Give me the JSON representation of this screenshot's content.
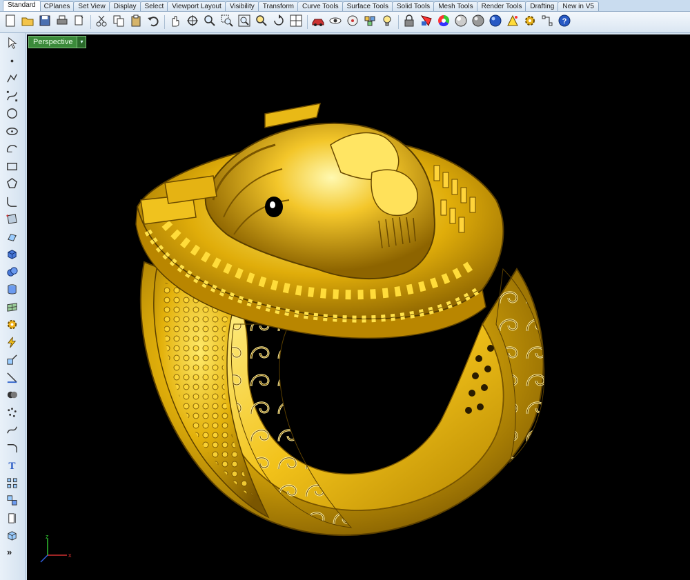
{
  "tabs": [
    {
      "label": "Standard",
      "active": true
    },
    {
      "label": "CPlanes"
    },
    {
      "label": "Set View"
    },
    {
      "label": "Display"
    },
    {
      "label": "Select"
    },
    {
      "label": "Viewport Layout"
    },
    {
      "label": "Visibility"
    },
    {
      "label": "Transform"
    },
    {
      "label": "Curve Tools"
    },
    {
      "label": "Surface Tools"
    },
    {
      "label": "Solid Tools"
    },
    {
      "label": "Mesh Tools"
    },
    {
      "label": "Render Tools"
    },
    {
      "label": "Drafting"
    },
    {
      "label": "New in V5"
    }
  ],
  "toolbar": {
    "icons": [
      "new-file-icon",
      "open-file-icon",
      "save-icon",
      "print-icon",
      "copy-properties-icon",
      "cut-icon",
      "copy-icon",
      "paste-icon",
      "undo-icon",
      "pan-hand-icon",
      "rotate-view-icon",
      "zoom-icon",
      "zoom-window-icon",
      "zoom-extents-icon",
      "zoom-selected-icon",
      "rotate-icon",
      "four-viewports-icon",
      "car-display-icon",
      "hide-icon",
      "sphere-select-icon",
      "layer-icon",
      "lightbulb-icon",
      "lock-icon",
      "properties-icon",
      "color-wheel-icon",
      "render-sphere-icon",
      "shaded-sphere-icon",
      "blue-sphere-icon",
      "highlight-icon",
      "settings-gear-icon",
      "snap-grid-icon",
      "help-icon"
    ]
  },
  "lefttoolbar": {
    "icons": [
      "select-arrow-icon",
      "point-icon",
      "polyline-icon",
      "curve-icon",
      "circle-icon",
      "ellipse-icon",
      "arc-icon",
      "rectangle-icon",
      "polygon-icon",
      "fillet-curve-icon",
      "surface-points-icon",
      "extrude-surface-icon",
      "box-solid-icon",
      "sphere-union-icon",
      "cylinder-icon",
      "mesh-icon",
      "gear-transform-icon",
      "lightning-icon",
      "split-icon",
      "trim-icon",
      "boolean-icon",
      "point-cloud-icon",
      "rebuild-curve-icon",
      "fillet-edge-icon",
      "text-icon",
      "array-icon",
      "group-icon",
      "dimension-icon",
      "box-3d-icon"
    ],
    "more_label": "»"
  },
  "viewport": {
    "title": "Perspective",
    "dropdown_glyph": "▾",
    "axis_x": "x",
    "axis_z": "z",
    "background": "#000000"
  },
  "colors": {
    "gold_light": "#ffe04a",
    "gold_mid": "#d9a400",
    "gold_dark": "#7a5600"
  }
}
